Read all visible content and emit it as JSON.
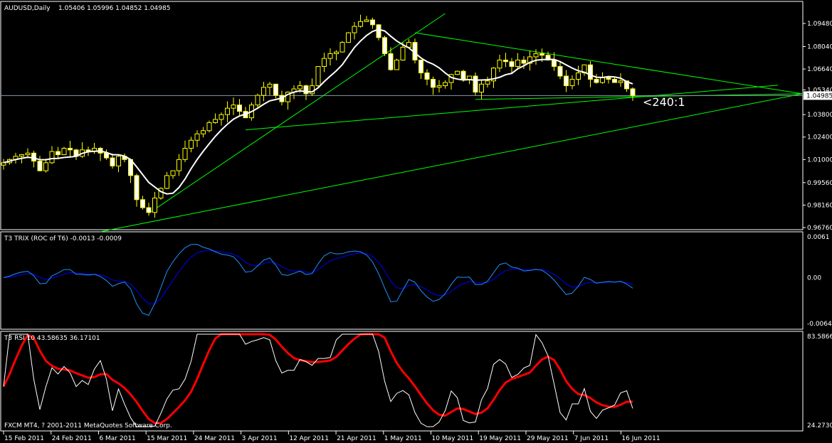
{
  "header": {
    "symbol_label": "AUDUSD,Daily",
    "ohlc": "1.05406 1.05996 1.04852 1.04985"
  },
  "annotation": "<240:1",
  "copyright": "FXCM MT4, ? 2001-2011 MetaQuotes Software Corp.",
  "colors": {
    "bg": "#000000",
    "grid": "#ffffff",
    "bull": "#000000",
    "bear": "#ffffff",
    "wick": "#ffff00",
    "ma": "#ffffff",
    "trend": "#00ff00",
    "trix": "#1e90ff",
    "trix_signal": "#0000ff",
    "rsi": "#ffffff",
    "rsi_signal": "#ff0000",
    "price_line": "#8899aa"
  },
  "chart_data": [
    {
      "type": "candlestick",
      "title": "AUDUSD,Daily",
      "price_axis": {
        "ticks": [
          "1.09480",
          "1.08040",
          "1.06640",
          "1.05340",
          "1.03800",
          "1.02400",
          "1.01000",
          "0.99560",
          "0.98160",
          "0.96760"
        ],
        "current": "1.04985",
        "ylim": [
          0.9676,
          1.0948
        ]
      },
      "x_ticks": [
        "15 Feb 2011",
        "24 Feb 2011",
        "6 Mar 2011",
        "15 Mar 2011",
        "24 Mar 2011",
        "3 Apr 2011",
        "12 Apr 2011",
        "21 Apr 2011",
        "1 May 2011",
        "10 May 2011",
        "19 May 2011",
        "29 May 2011",
        "7 Jun 2011",
        "16 Jun 2011"
      ],
      "first_open": 1.0065,
      "closes": [
        1.008,
        1.01,
        1.012,
        1.013,
        1.014,
        1.009,
        1.003,
        1.008,
        1.015,
        1.013,
        1.017,
        1.016,
        1.012,
        1.016,
        1.015,
        1.017,
        1.014,
        1.011,
        1.006,
        1.012,
        1.01,
        1.0,
        0.985,
        0.98,
        0.977,
        0.986,
        0.992,
        1.0,
        1.003,
        1.01,
        1.017,
        1.022,
        1.026,
        1.028,
        1.033,
        1.035,
        1.038,
        1.042,
        1.044,
        1.04,
        1.036,
        1.044,
        1.05,
        1.055,
        1.057,
        1.05,
        1.046,
        1.052,
        1.054,
        1.056,
        1.051,
        1.056,
        1.068,
        1.073,
        1.076,
        1.077,
        1.083,
        1.089,
        1.093,
        1.096,
        1.097,
        1.094,
        1.086,
        1.076,
        1.066,
        1.072,
        1.08,
        1.083,
        1.072,
        1.064,
        1.06,
        1.055,
        1.056,
        1.058,
        1.063,
        1.065,
        1.06,
        1.062,
        1.052,
        1.057,
        1.059,
        1.067,
        1.072,
        1.071,
        1.068,
        1.072,
        1.07,
        1.074,
        1.076,
        1.075,
        1.072,
        1.068,
        1.062,
        1.056,
        1.06,
        1.064,
        1.069,
        1.06,
        1.058,
        1.061,
        1.06,
        1.058,
        1.059,
        1.05406,
        1.04985
      ],
      "trendlines": [
        {
          "from": [
            24,
            0.9765
          ],
          "to": [
            73,
            1.101
          ]
        },
        {
          "from": [
            16,
            0.965
          ],
          "to": [
            132,
            1.051
          ]
        },
        {
          "from": [
            40,
            1.0285
          ],
          "to": [
            128,
            1.0563
          ]
        },
        {
          "from": [
            68,
            1.089
          ],
          "to": [
            132,
            1.051
          ]
        },
        {
          "from": [
            78,
            1.0475
          ],
          "to": [
            132,
            1.051
          ]
        }
      ]
    },
    {
      "type": "line",
      "title": "T3 TRIX (ROC of T6) -0.0013 -0.0009",
      "y_ticks": [
        "0.0061",
        "0.00",
        "-0.0064"
      ],
      "ylim": [
        -0.0064,
        0.0061
      ]
    },
    {
      "type": "line",
      "title": "T3 RSI 10 43.58635 36.17101",
      "y_ticks": [
        "83.5866",
        "24.2730"
      ],
      "ylim": [
        24.273,
        83.5866
      ]
    }
  ]
}
